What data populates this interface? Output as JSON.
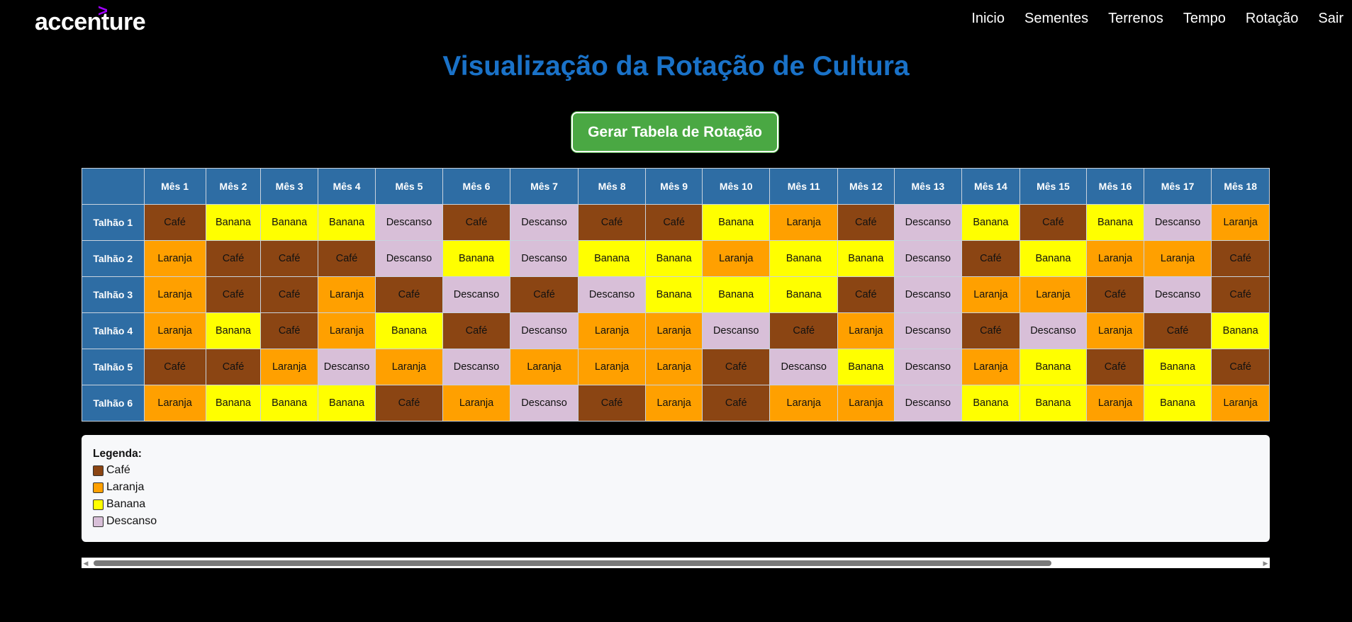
{
  "header": {
    "logo_text": "accenture",
    "logo_mark": ">",
    "nav": [
      "Inicio",
      "Sementes",
      "Terrenos",
      "Tempo",
      "Rotação",
      "Sair"
    ]
  },
  "page_title": "Visualização da Rotação de Cultura",
  "generate_button_label": "Gerar Tabela de Rotação",
  "colors": {
    "title": "#1a72c8",
    "header_bg": "#2e6da4",
    "button_bg": "#4aa843",
    "Café": "#8b4513",
    "Laranja": "#ffa000",
    "Banana": "#ffff00",
    "Descanso": "#d8bfd8"
  },
  "table": {
    "months": [
      "Mês 1",
      "Mês 2",
      "Mês 3",
      "Mês 4",
      "Mês 5",
      "Mês 6",
      "Mês 7",
      "Mês 8",
      "Mês 9",
      "Mês 10",
      "Mês 11",
      "Mês 12",
      "Mês 13",
      "Mês 14",
      "Mês 15",
      "Mês 16",
      "Mês 17",
      "Mês 18"
    ],
    "rows": [
      {
        "label": "Talhão 1",
        "cells": [
          "Café",
          "Banana",
          "Banana",
          "Banana",
          "Descanso",
          "Café",
          "Descanso",
          "Café",
          "Café",
          "Banana",
          "Laranja",
          "Café",
          "Descanso",
          "Banana",
          "Café",
          "Banana",
          "Descanso",
          "Laranja"
        ]
      },
      {
        "label": "Talhão 2",
        "cells": [
          "Laranja",
          "Café",
          "Café",
          "Café",
          "Descanso",
          "Banana",
          "Descanso",
          "Banana",
          "Banana",
          "Laranja",
          "Banana",
          "Banana",
          "Descanso",
          "Café",
          "Banana",
          "Laranja",
          "Laranja",
          "Café"
        ]
      },
      {
        "label": "Talhão 3",
        "cells": [
          "Laranja",
          "Café",
          "Café",
          "Laranja",
          "Café",
          "Descanso",
          "Café",
          "Descanso",
          "Banana",
          "Banana",
          "Banana",
          "Café",
          "Descanso",
          "Laranja",
          "Laranja",
          "Café",
          "Descanso",
          "Café"
        ]
      },
      {
        "label": "Talhão 4",
        "cells": [
          "Laranja",
          "Banana",
          "Café",
          "Laranja",
          "Banana",
          "Café",
          "Descanso",
          "Laranja",
          "Laranja",
          "Descanso",
          "Café",
          "Laranja",
          "Descanso",
          "Café",
          "Descanso",
          "Laranja",
          "Café",
          "Banana"
        ]
      },
      {
        "label": "Talhão 5",
        "cells": [
          "Café",
          "Café",
          "Laranja",
          "Descanso",
          "Laranja",
          "Descanso",
          "Laranja",
          "Laranja",
          "Laranja",
          "Café",
          "Descanso",
          "Banana",
          "Descanso",
          "Laranja",
          "Banana",
          "Café",
          "Banana",
          "Café"
        ]
      },
      {
        "label": "Talhão 6",
        "cells": [
          "Laranja",
          "Banana",
          "Banana",
          "Banana",
          "Café",
          "Laranja",
          "Descanso",
          "Café",
          "Laranja",
          "Café",
          "Laranja",
          "Laranja",
          "Descanso",
          "Banana",
          "Banana",
          "Laranja",
          "Banana",
          "Laranja"
        ]
      }
    ]
  },
  "legend": {
    "title": "Legenda:",
    "items": [
      "Café",
      "Laranja",
      "Banana",
      "Descanso"
    ]
  }
}
